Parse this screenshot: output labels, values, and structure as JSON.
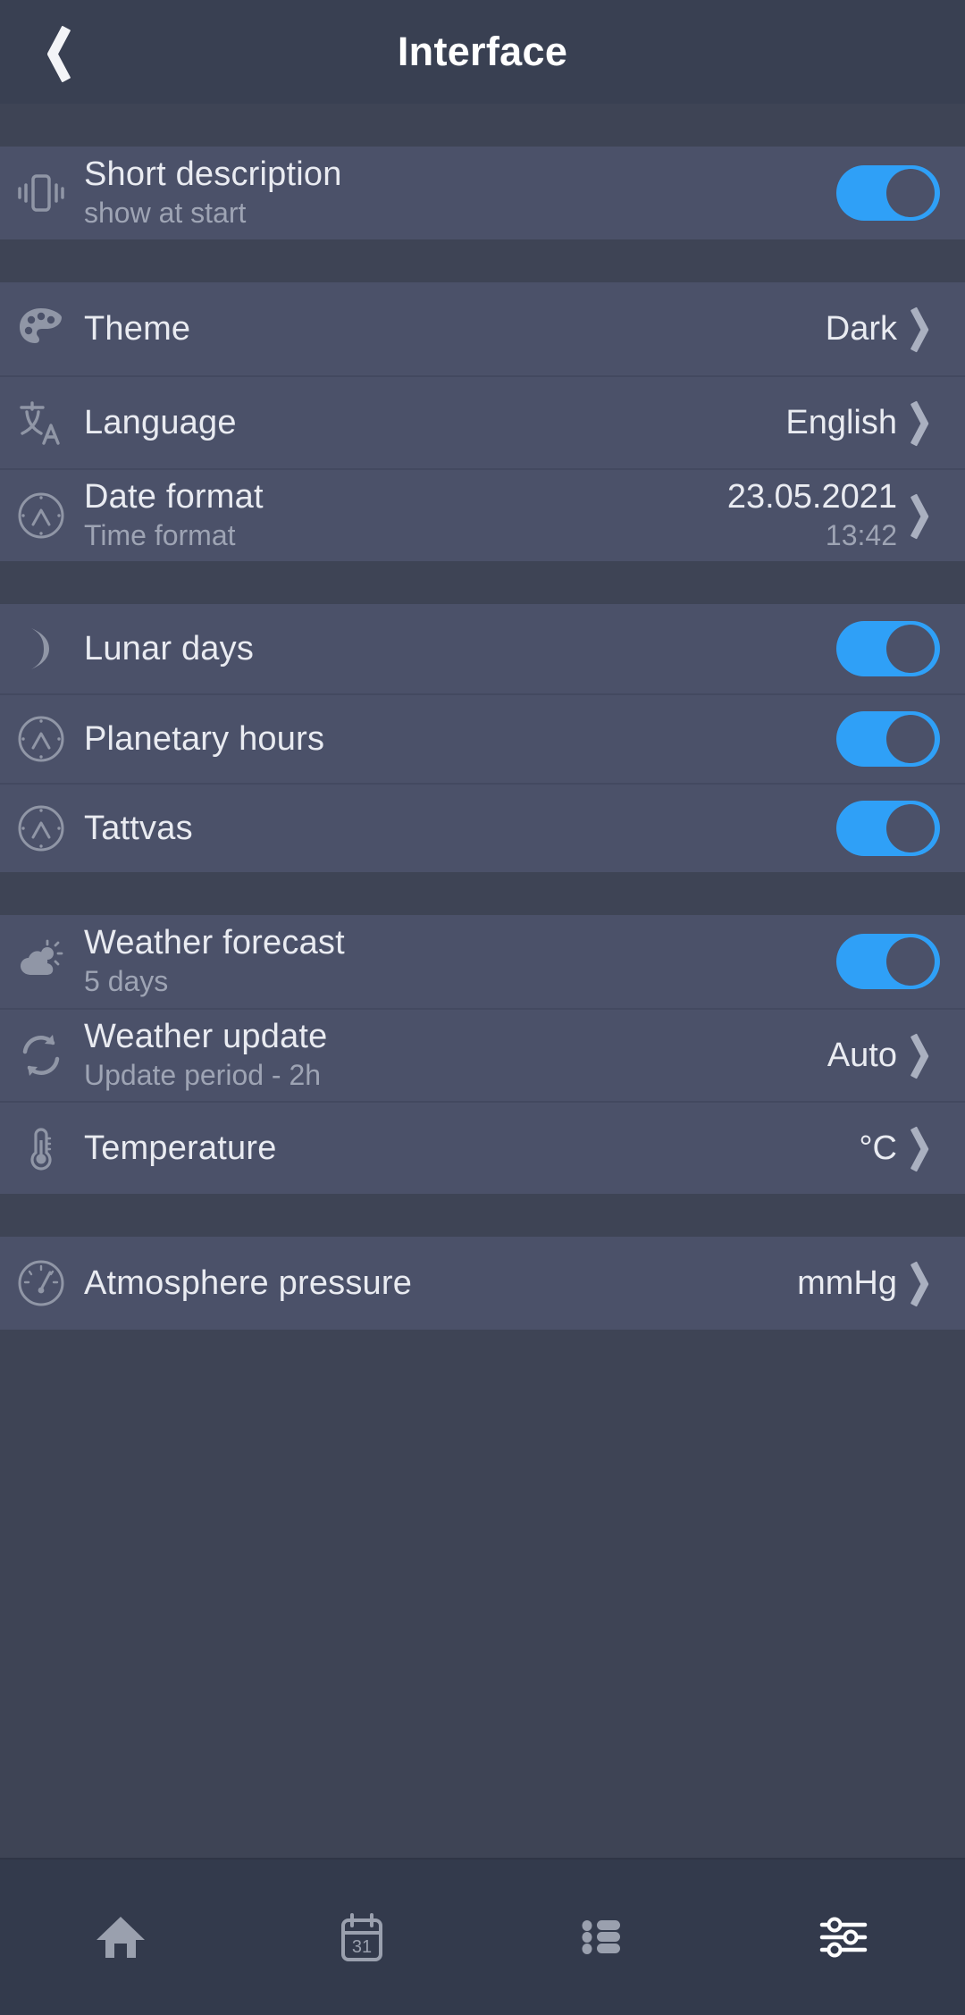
{
  "header": {
    "title": "Interface",
    "back_icon": "chevron-left-icon"
  },
  "colors": {
    "accent": "#2fa0f7",
    "row_bg": "#4b5169",
    "page_bg": "#3e4455",
    "header_bg": "#394052",
    "nav_bg": "#333a4c",
    "title_text": "#e9ebf1",
    "subtitle_text": "#9ea4b4"
  },
  "groups": [
    {
      "name": "group-short-description",
      "rows": [
        {
          "name": "row-short-description",
          "icon": "vibrate-icon",
          "title": "Short description",
          "subtitle": "show at start",
          "control": "toggle",
          "toggle_on": true
        }
      ]
    },
    {
      "name": "group-appearance",
      "rows": [
        {
          "name": "row-theme",
          "icon": "palette-icon",
          "title": "Theme",
          "subtitle": "",
          "control": "value-chevron",
          "value": "Dark",
          "value_sub": ""
        },
        {
          "name": "row-language",
          "icon": "translate-icon",
          "title": "Language",
          "subtitle": "",
          "control": "value-chevron",
          "value": "English",
          "value_sub": ""
        },
        {
          "name": "row-date-format",
          "icon": "clock-icon",
          "title": "Date format",
          "subtitle": "Time format",
          "control": "value-chevron",
          "value": "23.05.2021",
          "value_sub": "13:42"
        }
      ]
    },
    {
      "name": "group-astro",
      "rows": [
        {
          "name": "row-lunar-days",
          "icon": "moon-icon",
          "title": "Lunar days",
          "subtitle": "",
          "control": "toggle",
          "toggle_on": true
        },
        {
          "name": "row-planetary-hours",
          "icon": "clock-icon",
          "title": "Planetary hours",
          "subtitle": "",
          "control": "toggle",
          "toggle_on": true
        },
        {
          "name": "row-tattvas",
          "icon": "clock-icon",
          "title": "Tattvas",
          "subtitle": "",
          "control": "toggle",
          "toggle_on": true
        }
      ]
    },
    {
      "name": "group-weather",
      "rows": [
        {
          "name": "row-weather-forecast",
          "icon": "sun-cloud-icon",
          "title": "Weather forecast",
          "subtitle": "5 days",
          "control": "toggle",
          "toggle_on": true
        },
        {
          "name": "row-weather-update",
          "icon": "refresh-icon",
          "title": "Weather update",
          "subtitle": "Update period - 2h",
          "control": "value-chevron",
          "value": "Auto",
          "value_sub": ""
        },
        {
          "name": "row-temperature",
          "icon": "thermometer-icon",
          "title": "Temperature",
          "subtitle": "",
          "control": "value-chevron",
          "value": "°C",
          "value_sub": ""
        }
      ]
    },
    {
      "name": "group-pressure",
      "rows": [
        {
          "name": "row-atmosphere-pressure",
          "icon": "gauge-icon",
          "title": "Atmosphere pressure",
          "subtitle": "",
          "control": "value-chevron",
          "value": "mmHg",
          "value_sub": ""
        }
      ]
    }
  ],
  "bottom_nav": {
    "items": [
      {
        "name": "nav-home",
        "icon": "home-icon",
        "active": false
      },
      {
        "name": "nav-calendar",
        "icon": "calendar-icon",
        "active": false,
        "day": "31"
      },
      {
        "name": "nav-list",
        "icon": "list-icon",
        "active": false
      },
      {
        "name": "nav-settings",
        "icon": "sliders-icon",
        "active": true
      }
    ]
  }
}
